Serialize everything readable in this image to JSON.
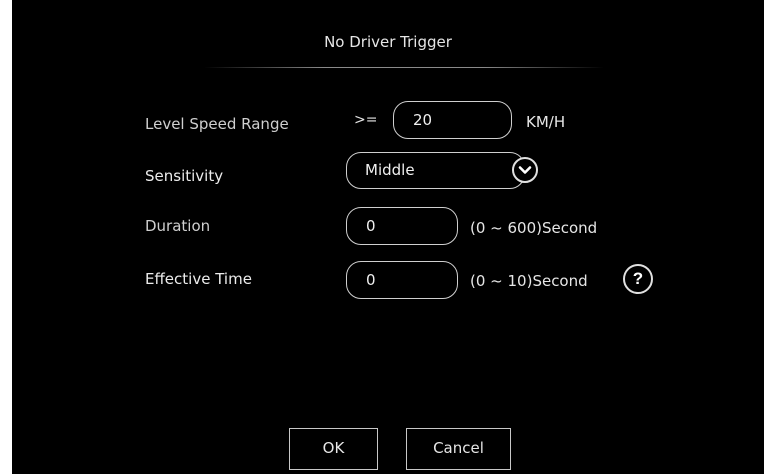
{
  "dialog": {
    "title": "No Driver Trigger",
    "rows": {
      "level_speed_range": {
        "label": "Level Speed Range",
        "operator": ">=",
        "value": "20",
        "unit": "KM/H"
      },
      "sensitivity": {
        "label": "Sensitivity",
        "selected": "Middle",
        "arrow_icon": "chevron-down-icon"
      },
      "duration": {
        "label": "Duration",
        "value": "0",
        "range_hint": "(0 ~ 600)Second"
      },
      "effective_time": {
        "label": "Effective Time",
        "value": "0",
        "range_hint": "(0 ~ 10)Second",
        "help_label": "?"
      }
    },
    "buttons": {
      "ok": "OK",
      "cancel": "Cancel"
    },
    "colors": {
      "background": "#000000",
      "text": "#d0d0d0",
      "border": "#cfcfcf"
    }
  }
}
